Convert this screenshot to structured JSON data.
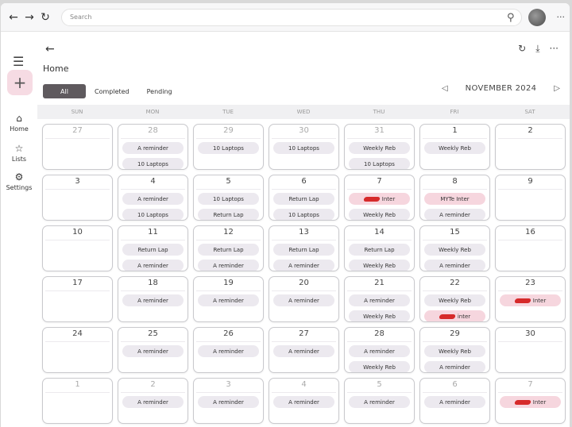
{
  "browser": {
    "search_placeholder": "Search"
  },
  "page": {
    "title": "Home",
    "filters": [
      "All",
      "Completed",
      "Pending"
    ],
    "active_filter": "All",
    "month_label": "NOVEMBER 2024"
  },
  "sidebar": {
    "items": [
      {
        "label": "Home",
        "icon": "home-icon"
      },
      {
        "label": "Lists",
        "icon": "star-icon"
      },
      {
        "label": "Settings",
        "icon": "gear-icon"
      }
    ]
  },
  "calendar": {
    "weekdays": [
      "SUN",
      "MON",
      "TUE",
      "WED",
      "THU",
      "FRI",
      "SAT"
    ],
    "weeks": [
      [
        {
          "day": "27",
          "other": true,
          "events": []
        },
        {
          "day": "28",
          "other": true,
          "events": [
            {
              "text": "A reminder"
            },
            {
              "text": "10 Laptops"
            }
          ]
        },
        {
          "day": "29",
          "other": true,
          "events": [
            {
              "text": "10 Laptops"
            }
          ]
        },
        {
          "day": "30",
          "other": true,
          "events": [
            {
              "text": "10 Laptops"
            }
          ]
        },
        {
          "day": "31",
          "other": true,
          "events": [
            {
              "text": "Weekly Reb"
            },
            {
              "text": "10 Laptops"
            }
          ]
        },
        {
          "day": "1",
          "other": false,
          "events": [
            {
              "text": "Weekly Reb"
            }
          ]
        },
        {
          "day": "2",
          "other": false,
          "events": []
        }
      ],
      [
        {
          "day": "3",
          "other": false,
          "events": []
        },
        {
          "day": "4",
          "other": false,
          "events": [
            {
              "text": "A reminder"
            },
            {
              "text": "10 Laptops"
            }
          ]
        },
        {
          "day": "5",
          "other": false,
          "events": [
            {
              "text": "10 Laptops"
            },
            {
              "text": "Return Lap"
            }
          ]
        },
        {
          "day": "6",
          "other": false,
          "events": [
            {
              "text": "Return Lap"
            },
            {
              "text": "10 Laptops"
            }
          ]
        },
        {
          "day": "7",
          "other": false,
          "events": [
            {
              "text": "Inter",
              "pink": true,
              "redacted": true
            },
            {
              "text": "Weekly Reb"
            }
          ]
        },
        {
          "day": "8",
          "other": false,
          "events": [
            {
              "text": "MYTe Inter",
              "pink": true
            },
            {
              "text": "A reminder"
            }
          ]
        },
        {
          "day": "9",
          "other": false,
          "events": []
        }
      ],
      [
        {
          "day": "10",
          "other": false,
          "events": []
        },
        {
          "day": "11",
          "other": false,
          "events": [
            {
              "text": "Return Lap"
            },
            {
              "text": "A reminder"
            }
          ]
        },
        {
          "day": "12",
          "other": false,
          "events": [
            {
              "text": "Return Lap"
            },
            {
              "text": "A reminder"
            }
          ]
        },
        {
          "day": "13",
          "other": false,
          "events": [
            {
              "text": "Return Lap"
            },
            {
              "text": "A reminder"
            }
          ]
        },
        {
          "day": "14",
          "other": false,
          "events": [
            {
              "text": "Return Lap"
            },
            {
              "text": "Weekly Reb"
            }
          ]
        },
        {
          "day": "15",
          "other": false,
          "events": [
            {
              "text": "Weekly Reb"
            },
            {
              "text": "A reminder"
            }
          ]
        },
        {
          "day": "16",
          "other": false,
          "events": []
        }
      ],
      [
        {
          "day": "17",
          "other": false,
          "events": []
        },
        {
          "day": "18",
          "other": false,
          "events": [
            {
              "text": "A reminder"
            }
          ]
        },
        {
          "day": "19",
          "other": false,
          "events": [
            {
              "text": "A reminder"
            }
          ]
        },
        {
          "day": "20",
          "other": false,
          "events": [
            {
              "text": "A reminder"
            }
          ]
        },
        {
          "day": "21",
          "other": false,
          "events": [
            {
              "text": "A reminder"
            },
            {
              "text": "Weekly Reb"
            }
          ]
        },
        {
          "day": "22",
          "other": false,
          "events": [
            {
              "text": "Weekly Reb"
            },
            {
              "text": "inter",
              "pink": true,
              "redacted": true
            }
          ]
        },
        {
          "day": "23",
          "other": false,
          "events": [
            {
              "text": "Inter",
              "pink": true,
              "redacted": true
            }
          ]
        }
      ],
      [
        {
          "day": "24",
          "other": false,
          "events": []
        },
        {
          "day": "25",
          "other": false,
          "events": [
            {
              "text": "A reminder"
            }
          ]
        },
        {
          "day": "26",
          "other": false,
          "events": [
            {
              "text": "A reminder"
            }
          ]
        },
        {
          "day": "27",
          "other": false,
          "events": [
            {
              "text": "A reminder"
            }
          ]
        },
        {
          "day": "28",
          "other": false,
          "events": [
            {
              "text": "A reminder"
            },
            {
              "text": "Weekly Reb"
            }
          ]
        },
        {
          "day": "29",
          "other": false,
          "events": [
            {
              "text": "Weekly Reb"
            },
            {
              "text": "A reminder"
            }
          ]
        },
        {
          "day": "30",
          "other": false,
          "events": []
        }
      ],
      [
        {
          "day": "1",
          "other": true,
          "events": []
        },
        {
          "day": "2",
          "other": true,
          "events": [
            {
              "text": "A reminder"
            }
          ]
        },
        {
          "day": "3",
          "other": true,
          "events": [
            {
              "text": "A reminder"
            }
          ]
        },
        {
          "day": "4",
          "other": true,
          "events": [
            {
              "text": "A reminder"
            }
          ]
        },
        {
          "day": "5",
          "other": true,
          "events": [
            {
              "text": "A reminder"
            }
          ]
        },
        {
          "day": "6",
          "other": true,
          "events": [
            {
              "text": "A reminder"
            }
          ]
        },
        {
          "day": "7",
          "other": true,
          "events": [
            {
              "text": "Inter",
              "pink": true,
              "redacted": true
            }
          ]
        }
      ]
    ]
  }
}
